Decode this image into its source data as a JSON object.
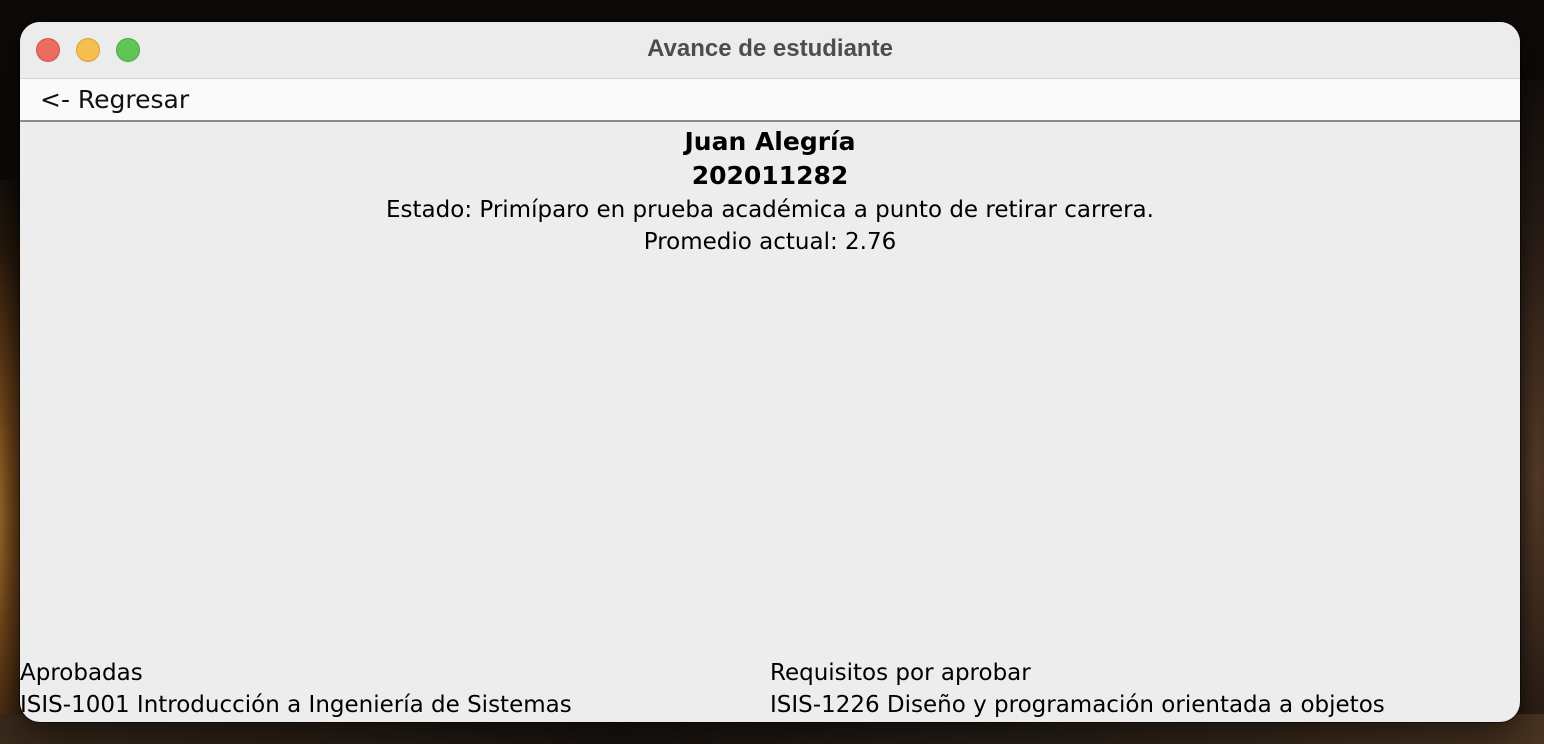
{
  "window": {
    "title": "Avance de estudiante"
  },
  "toolbar": {
    "back_label": "<- Regresar"
  },
  "student": {
    "name": "Juan Alegría",
    "id": "202011282",
    "status": "Estado: Primíparo en prueba académica a punto de retirar carrera.",
    "gpa": "Promedio actual: 2.76"
  },
  "approved": {
    "heading": "Aprobadas",
    "items": [
      "ISIS-1001 Introducción a Ingeniería de Sistemas"
    ]
  },
  "pending": {
    "heading": "Requisitos por aprobar",
    "items": [
      "ISIS-1226 Diseño y programación orientada a objetos"
    ]
  },
  "colors": {
    "close": "#ec6a5e",
    "minimize": "#f4bf4f",
    "zoom": "#61c554",
    "window_bg": "#ededed"
  }
}
